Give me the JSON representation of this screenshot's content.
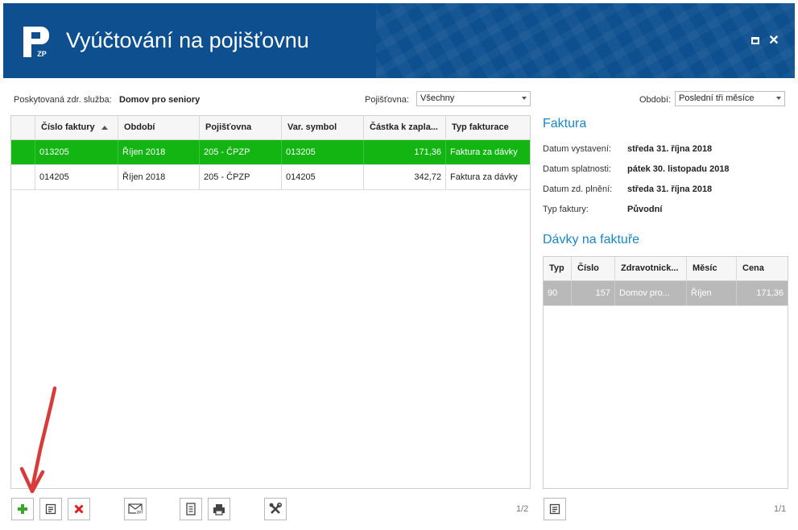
{
  "window": {
    "title": "Vyúčtování na pojišťovnu",
    "logo_text": "ZP"
  },
  "filters": {
    "service_label": "Poskytovaná zdr. služba:",
    "service_value": "Domov pro seniory",
    "insurer_label": "Pojišťovna:",
    "insurer_value": "Všechny",
    "period_label": "Období:",
    "period_value": "Poslední tři měsíce"
  },
  "invoices": {
    "columns": [
      "Číslo faktury",
      "Období",
      "Pojišťovna",
      "Var. symbol",
      "Částka k zapla...",
      "Typ fakturace"
    ],
    "rows": [
      {
        "number": "013205",
        "period": "Říjen 2018",
        "insurer": "205 - ČPZP",
        "var_symbol": "013205",
        "amount": "171,36",
        "type": "Faktura za dávky",
        "selected": true
      },
      {
        "number": "014205",
        "period": "Říjen 2018",
        "insurer": "205 - ČPZP",
        "var_symbol": "014205",
        "amount": "342,72",
        "type": "Faktura za dávky",
        "selected": false
      }
    ],
    "pager": "1/2"
  },
  "invoice_detail": {
    "heading": "Faktura",
    "issued_label": "Datum vystavení:",
    "issued_value": "středa 31. října 2018",
    "due_label": "Datum splatnosti:",
    "due_value": "pátek 30. listopadu 2018",
    "supply_label": "Datum zd. plnění:",
    "supply_value": "středa 31. října 2018",
    "type_label": "Typ faktury:",
    "type_value": "Původní"
  },
  "batches": {
    "heading": "Dávky na faktuře",
    "columns": [
      "Typ",
      "Číslo",
      "Zdravotnick...",
      "Měsíc",
      "Cena"
    ],
    "rows": [
      {
        "type": "90",
        "number": "157",
        "facility": "Domov pro...",
        "month": "Říjen",
        "price": "171,36"
      }
    ],
    "pager": "1/1"
  },
  "colors": {
    "titlebar": "#0d4f8f",
    "selected_row": "#12b512",
    "section_title": "#1a86c7"
  },
  "icons": [
    "add-icon",
    "edit-document-icon",
    "delete-icon",
    "zp-mail-icon",
    "document-icon",
    "print-icon",
    "tools-icon",
    "batch-edit-icon"
  ]
}
